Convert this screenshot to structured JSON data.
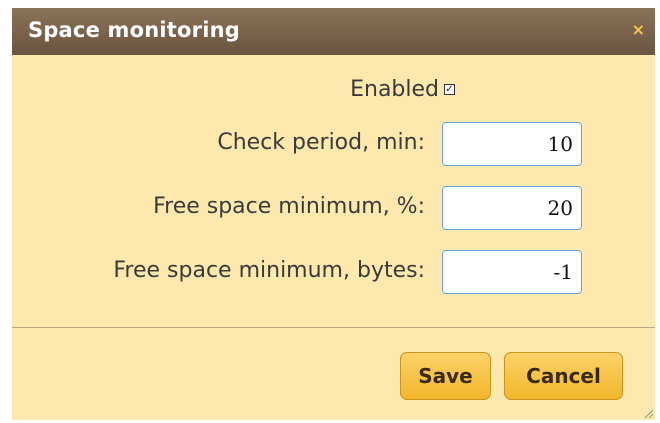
{
  "dialog": {
    "title": "Space monitoring",
    "close_glyph": "×"
  },
  "form": {
    "enabled_label": "Enabled",
    "enabled_checked": true,
    "check_period_label": "Check period, min:",
    "check_period_value": "10",
    "free_space_percent_label": "Free space minimum, %:",
    "free_space_percent_value": "20",
    "free_space_bytes_label": "Free space minimum, bytes:",
    "free_space_bytes_value": "-1"
  },
  "buttons": {
    "save_label": "Save",
    "cancel_label": "Cancel"
  },
  "colors": {
    "title_bar": "#7a6249",
    "dialog_bg": "#fde9ad",
    "button": "#f6c03f",
    "close": "#f6c94b"
  },
  "icons": {
    "close": "close-icon",
    "checkbox": "checkbox-icon",
    "resize": "resize-grip-icon"
  }
}
